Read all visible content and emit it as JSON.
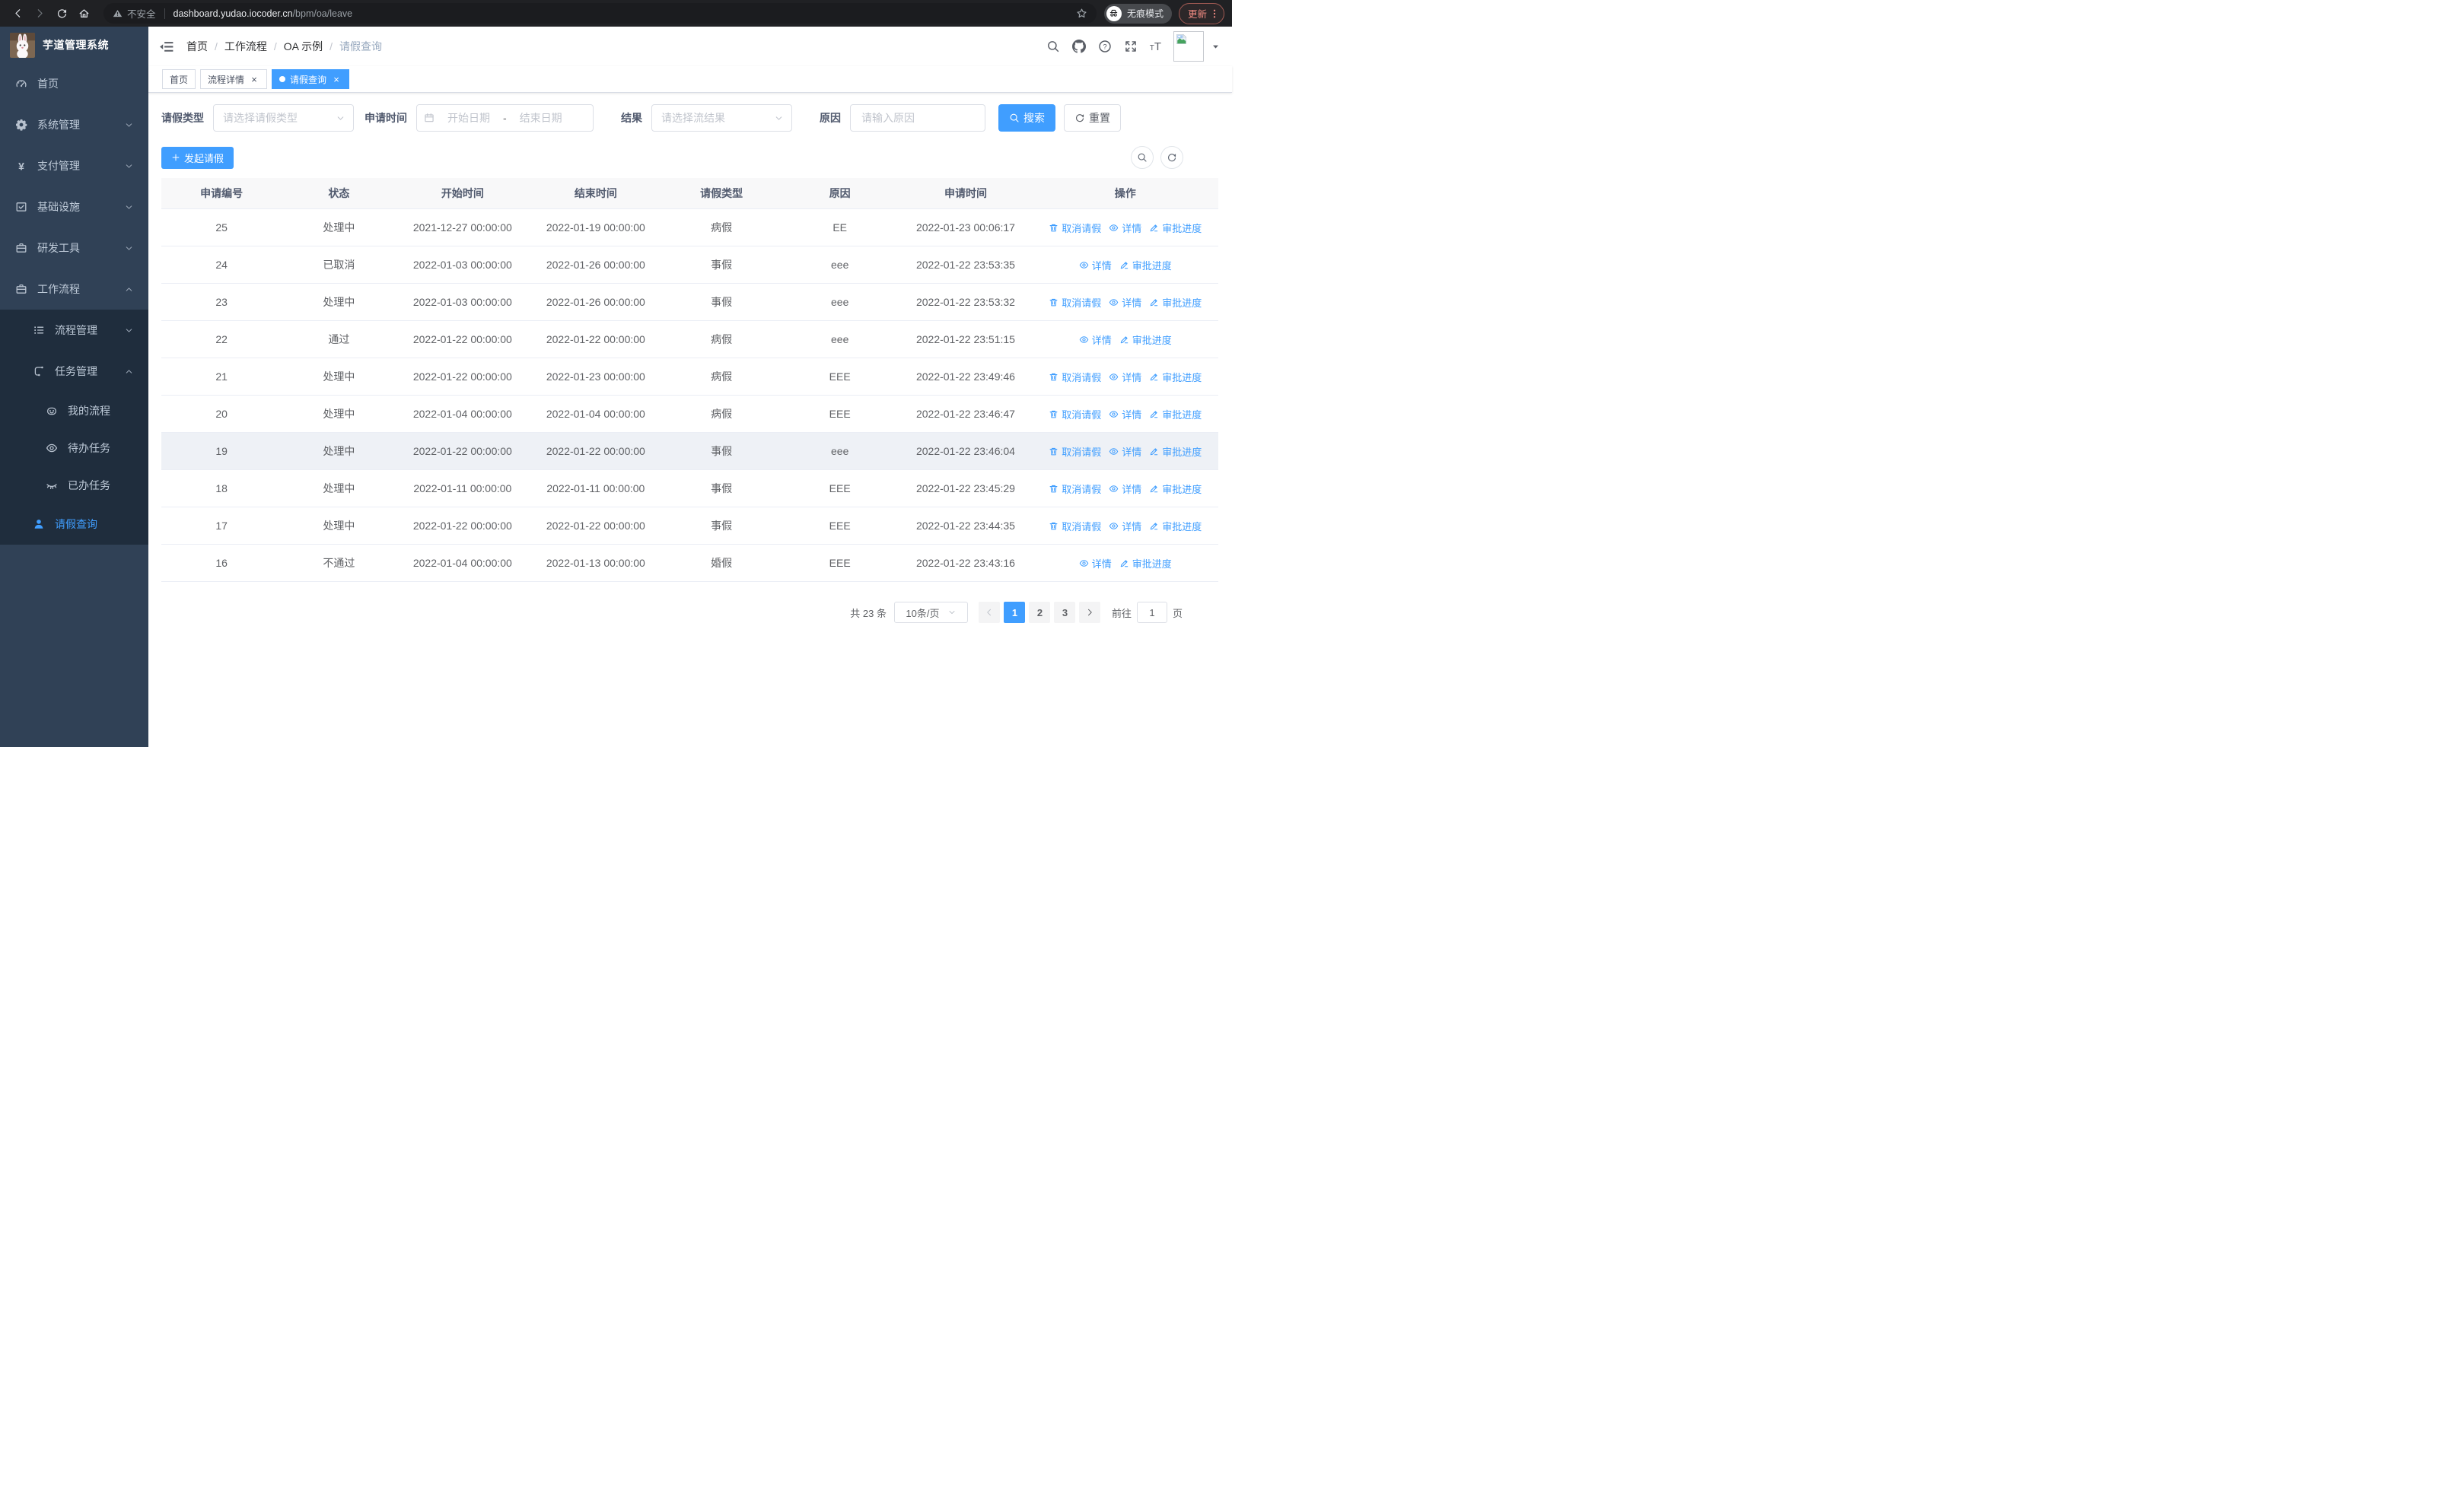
{
  "browser": {
    "security_label": "不安全",
    "url_host": "dashboard.yudao.iocoder.cn",
    "url_path": "/bpm/oa/leave",
    "incognito_label": "无痕模式",
    "update_label": "更新"
  },
  "sidebar": {
    "app_title": "芋道管理系统",
    "items": [
      {
        "label": "首页",
        "icon": "dashboard",
        "level": 0,
        "sub": false
      },
      {
        "label": "系统管理",
        "icon": "gear",
        "level": 0,
        "chevron": "down",
        "sub": false
      },
      {
        "label": "支付管理",
        "icon": "yen",
        "level": 0,
        "chevron": "down",
        "sub": false
      },
      {
        "label": "基础设施",
        "icon": "infrastructure",
        "level": 0,
        "chevron": "down",
        "sub": false
      },
      {
        "label": "研发工具",
        "icon": "toolbox",
        "level": 0,
        "chevron": "down",
        "sub": false
      },
      {
        "label": "工作流程",
        "icon": "workflow",
        "level": 0,
        "chevron": "up",
        "sub": false
      },
      {
        "label": "流程管理",
        "icon": "process-list",
        "level": 1,
        "chevron": "down",
        "sub": true
      },
      {
        "label": "任务管理",
        "icon": "task-flow",
        "level": 1,
        "chevron": "up",
        "sub": true
      },
      {
        "label": "我的流程",
        "icon": "robot",
        "level": 2,
        "sub": true
      },
      {
        "label": "待办任务",
        "icon": "eye",
        "level": 2,
        "sub": true
      },
      {
        "label": "已办任务",
        "icon": "eye-closed",
        "level": 2,
        "sub": true
      },
      {
        "label": "请假查询",
        "icon": "user",
        "level": 1,
        "sub": true,
        "active": true
      }
    ]
  },
  "header": {
    "breadcrumb": {
      "items": [
        "首页",
        "工作流程",
        "OA 示例",
        "请假查询"
      ],
      "separator": "/"
    }
  },
  "tabs": [
    {
      "label": "首页",
      "closable": false,
      "active": false
    },
    {
      "label": "流程详情",
      "closable": true,
      "active": false
    },
    {
      "label": "请假查询",
      "closable": true,
      "active": true
    }
  ],
  "filters": {
    "leave_type_label": "请假类型",
    "leave_type_placeholder": "请选择请假类型",
    "apply_time_label": "申请时间",
    "start_placeholder": "开始日期",
    "range_separator": "-",
    "end_placeholder": "结束日期",
    "result_label": "结果",
    "result_placeholder": "请选择流结果",
    "reason_label": "原因",
    "reason_placeholder": "请输入原因",
    "search_label": "搜索",
    "reset_label": "重置"
  },
  "toolbar": {
    "create_label": "发起请假"
  },
  "table": {
    "columns": [
      "申请编号",
      "状态",
      "开始时间",
      "结束时间",
      "请假类型",
      "原因",
      "申请时间",
      "操作"
    ],
    "action_labels": {
      "cancel": "取消请假",
      "detail": "详情",
      "progress": "审批进度"
    },
    "rows": [
      {
        "id": "25",
        "status": "处理中",
        "start": "2021-12-27 00:00:00",
        "end": "2022-01-19 00:00:00",
        "type": "病假",
        "reason": "EE",
        "applied": "2022-01-23 00:06:17",
        "cancelable": true,
        "highlight": false
      },
      {
        "id": "24",
        "status": "已取消",
        "start": "2022-01-03 00:00:00",
        "end": "2022-01-26 00:00:00",
        "type": "事假",
        "reason": "eee",
        "applied": "2022-01-22 23:53:35",
        "cancelable": false,
        "highlight": false
      },
      {
        "id": "23",
        "status": "处理中",
        "start": "2022-01-03 00:00:00",
        "end": "2022-01-26 00:00:00",
        "type": "事假",
        "reason": "eee",
        "applied": "2022-01-22 23:53:32",
        "cancelable": true,
        "highlight": false
      },
      {
        "id": "22",
        "status": "通过",
        "start": "2022-01-22 00:00:00",
        "end": "2022-01-22 00:00:00",
        "type": "病假",
        "reason": "eee",
        "applied": "2022-01-22 23:51:15",
        "cancelable": false,
        "highlight": false
      },
      {
        "id": "21",
        "status": "处理中",
        "start": "2022-01-22 00:00:00",
        "end": "2022-01-23 00:00:00",
        "type": "病假",
        "reason": "EEE",
        "applied": "2022-01-22 23:49:46",
        "cancelable": true,
        "highlight": false
      },
      {
        "id": "20",
        "status": "处理中",
        "start": "2022-01-04 00:00:00",
        "end": "2022-01-04 00:00:00",
        "type": "病假",
        "reason": "EEE",
        "applied": "2022-01-22 23:46:47",
        "cancelable": true,
        "highlight": false
      },
      {
        "id": "19",
        "status": "处理中",
        "start": "2022-01-22 00:00:00",
        "end": "2022-01-22 00:00:00",
        "type": "事假",
        "reason": "eee",
        "applied": "2022-01-22 23:46:04",
        "cancelable": true,
        "highlight": true
      },
      {
        "id": "18",
        "status": "处理中",
        "start": "2022-01-11 00:00:00",
        "end": "2022-01-11 00:00:00",
        "type": "事假",
        "reason": "EEE",
        "applied": "2022-01-22 23:45:29",
        "cancelable": true,
        "highlight": false
      },
      {
        "id": "17",
        "status": "处理中",
        "start": "2022-01-22 00:00:00",
        "end": "2022-01-22 00:00:00",
        "type": "事假",
        "reason": "EEE",
        "applied": "2022-01-22 23:44:35",
        "cancelable": true,
        "highlight": false
      },
      {
        "id": "16",
        "status": "不通过",
        "start": "2022-01-04 00:00:00",
        "end": "2022-01-13 00:00:00",
        "type": "婚假",
        "reason": "EEE",
        "applied": "2022-01-22 23:43:16",
        "cancelable": false,
        "highlight": false
      }
    ]
  },
  "pagination": {
    "total_label": "共 23 条",
    "page_size_label": "10条/页",
    "pages": [
      "1",
      "2",
      "3"
    ],
    "active_page": "1",
    "goto_label": "前往",
    "goto_value": "1",
    "goto_unit": "页"
  },
  "colors": {
    "accent": "#409eff",
    "sidebar_bg": "#304156",
    "submenu_bg": "#1f2d3d",
    "table_header_bg": "#f8f8f9",
    "row_highlight": "#eef1f6",
    "chrome_bg": "#202124",
    "update_accent": "#f28b82"
  }
}
